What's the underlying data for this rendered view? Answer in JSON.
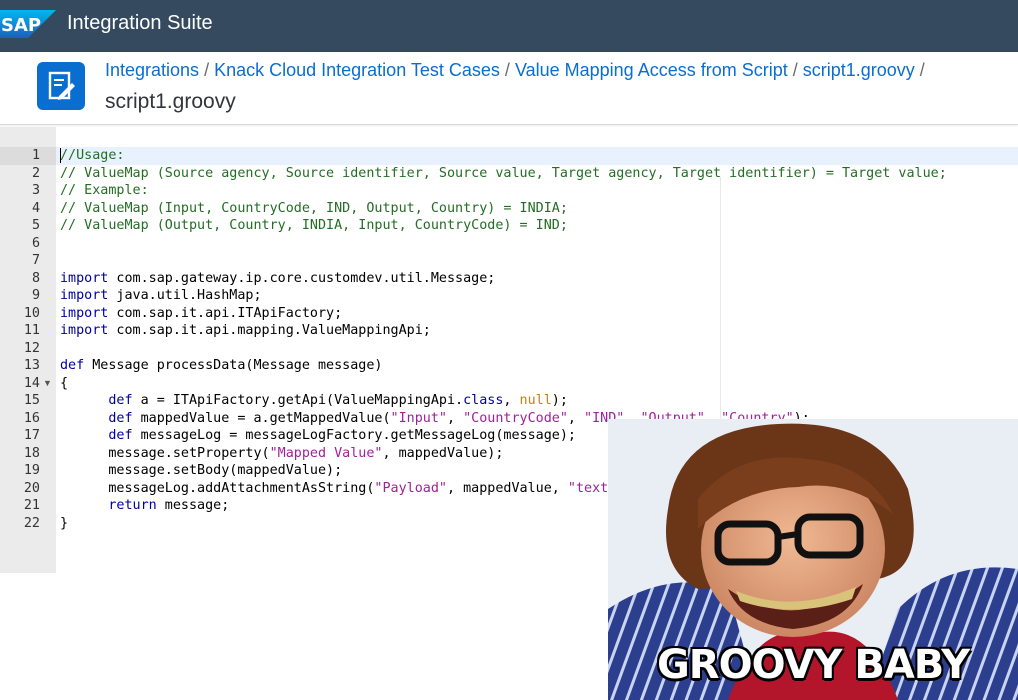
{
  "shell": {
    "logo": "SAP",
    "app_title": "Integration Suite",
    "brand_color": "#354a5f"
  },
  "header": {
    "breadcrumb": [
      "Integrations",
      "Knack Cloud Integration Test Cases",
      "Value Mapping Access from Script",
      "script1.groovy"
    ],
    "title": "script1.groovy",
    "icon": "script-edit-icon"
  },
  "editor": {
    "active_line": 1,
    "lines": [
      "//Usage:",
      "// ValueMap (Source agency, Source identifier, Source value, Target agency, Target identifier) = Target value;",
      "// Example:",
      "// ValueMap (Input, CountryCode, IND, Output, Country) = INDIA;",
      "// ValueMap (Output, Country, INDIA, Input, CountryCode) = IND;",
      "",
      "",
      "import com.sap.gateway.ip.core.customdev.util.Message;",
      "import java.util.HashMap;",
      "import com.sap.it.api.ITApiFactory;",
      "import com.sap.it.api.mapping.ValueMappingApi;",
      "",
      "def Message processData(Message message)",
      "{",
      "      def a = ITApiFactory.getApi(ValueMappingApi.class, null);",
      "      def mappedValue = a.getMappedValue(\"Input\", \"CountryCode\", \"IND\", \"Output\", \"Country\");",
      "      def messageLog = messageLogFactory.getMessageLog(message);",
      "      message.setProperty(\"Mapped Value\", mappedValue);",
      "      message.setBody(mappedValue);",
      "      messageLog.addAttachmentAsString(\"Payload\", mappedValue, \"text/plain\");",
      "      return message;",
      "}"
    ]
  },
  "meme": {
    "caption": "GROOVY BABY"
  }
}
